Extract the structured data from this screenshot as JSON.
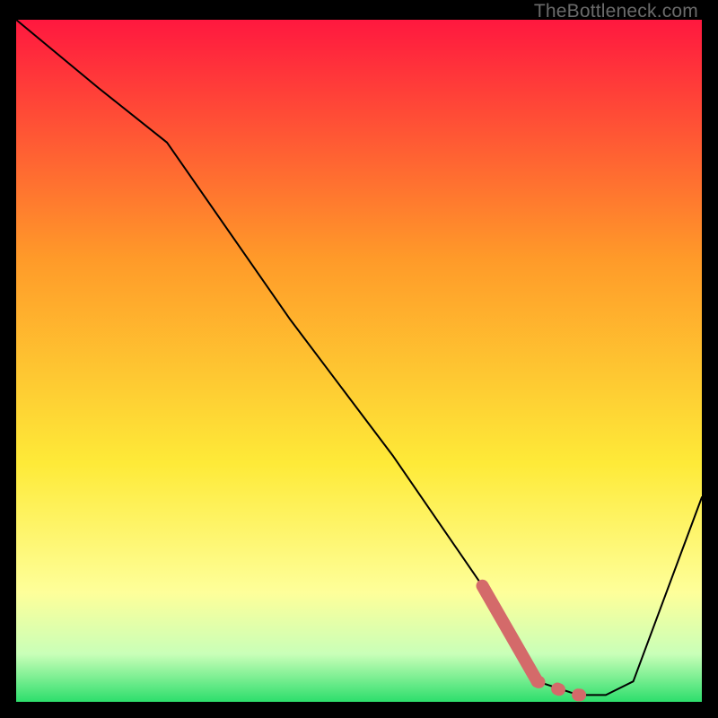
{
  "watermark": "TheBottleneck.com",
  "colors": {
    "top": "#ff183f",
    "orange": "#ff9a29",
    "yellow": "#feea38",
    "yellow_pale": "#feff9a",
    "pale_green": "#c9ffb8",
    "green": "#2dde6c",
    "curve_stroke": "#000000",
    "dash_stroke": "#d46a6a"
  },
  "chart_data": {
    "type": "line",
    "title": "",
    "xlabel": "",
    "ylabel": "",
    "xlim": [
      0,
      100
    ],
    "ylim": [
      0,
      100
    ],
    "series": [
      {
        "name": "bottleneck-curve",
        "x": [
          0,
          12,
          22,
          40,
          55,
          68,
          72,
          76,
          82,
          86,
          90,
          100
        ],
        "y": [
          100,
          90,
          82,
          56,
          36,
          17,
          10,
          3,
          1,
          1,
          3,
          30
        ]
      }
    ],
    "highlight_segment": {
      "name": "highlight-dash",
      "x": [
        68,
        72,
        76,
        80,
        82,
        85
      ],
      "y": [
        17,
        10,
        3,
        1.5,
        1,
        1
      ]
    }
  }
}
